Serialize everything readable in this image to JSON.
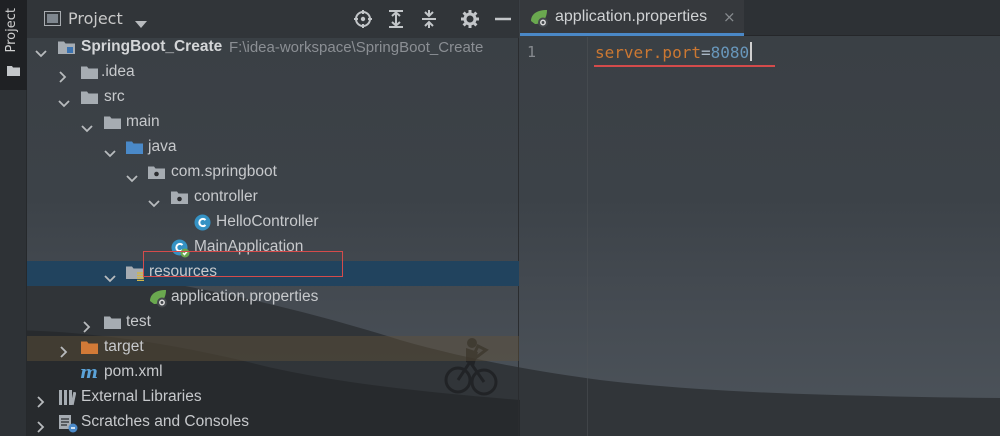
{
  "stripe": {
    "tab_label": "Project"
  },
  "panel": {
    "title": "Project",
    "buttons": [
      "locate-icon",
      "expand-all-icon",
      "collapse-all-icon",
      "settings-icon",
      "hide-icon"
    ]
  },
  "tree": {
    "root": {
      "label": "SpringBoot_Create",
      "path": "F:\\idea-workspace\\SpringBoot_Create"
    },
    "idea": "idea",
    "src": "src",
    "main": "main",
    "java": "java",
    "package": "com.springboot",
    "controller": "controller",
    "hello_controller": "HelloController",
    "main_application": "MainApplication",
    "resources": "resources",
    "application_properties": "application.properties",
    "test": "test",
    "target": "target",
    "pom": "pom.xml",
    "external_libraries": "External Libraries",
    "scratches": "Scratches and Consoles"
  },
  "editor": {
    "tab_label": "application.properties",
    "tab_close": "×",
    "line_number": "1",
    "code": {
      "key": "server.port",
      "equals": "=",
      "value": "8080"
    }
  },
  "colors": {
    "selection": "#21435e",
    "highlight_red": "#d44b4b",
    "tab_accent": "#4a88c7",
    "property_key": "#cc7832",
    "property_value": "#6897bb"
  }
}
